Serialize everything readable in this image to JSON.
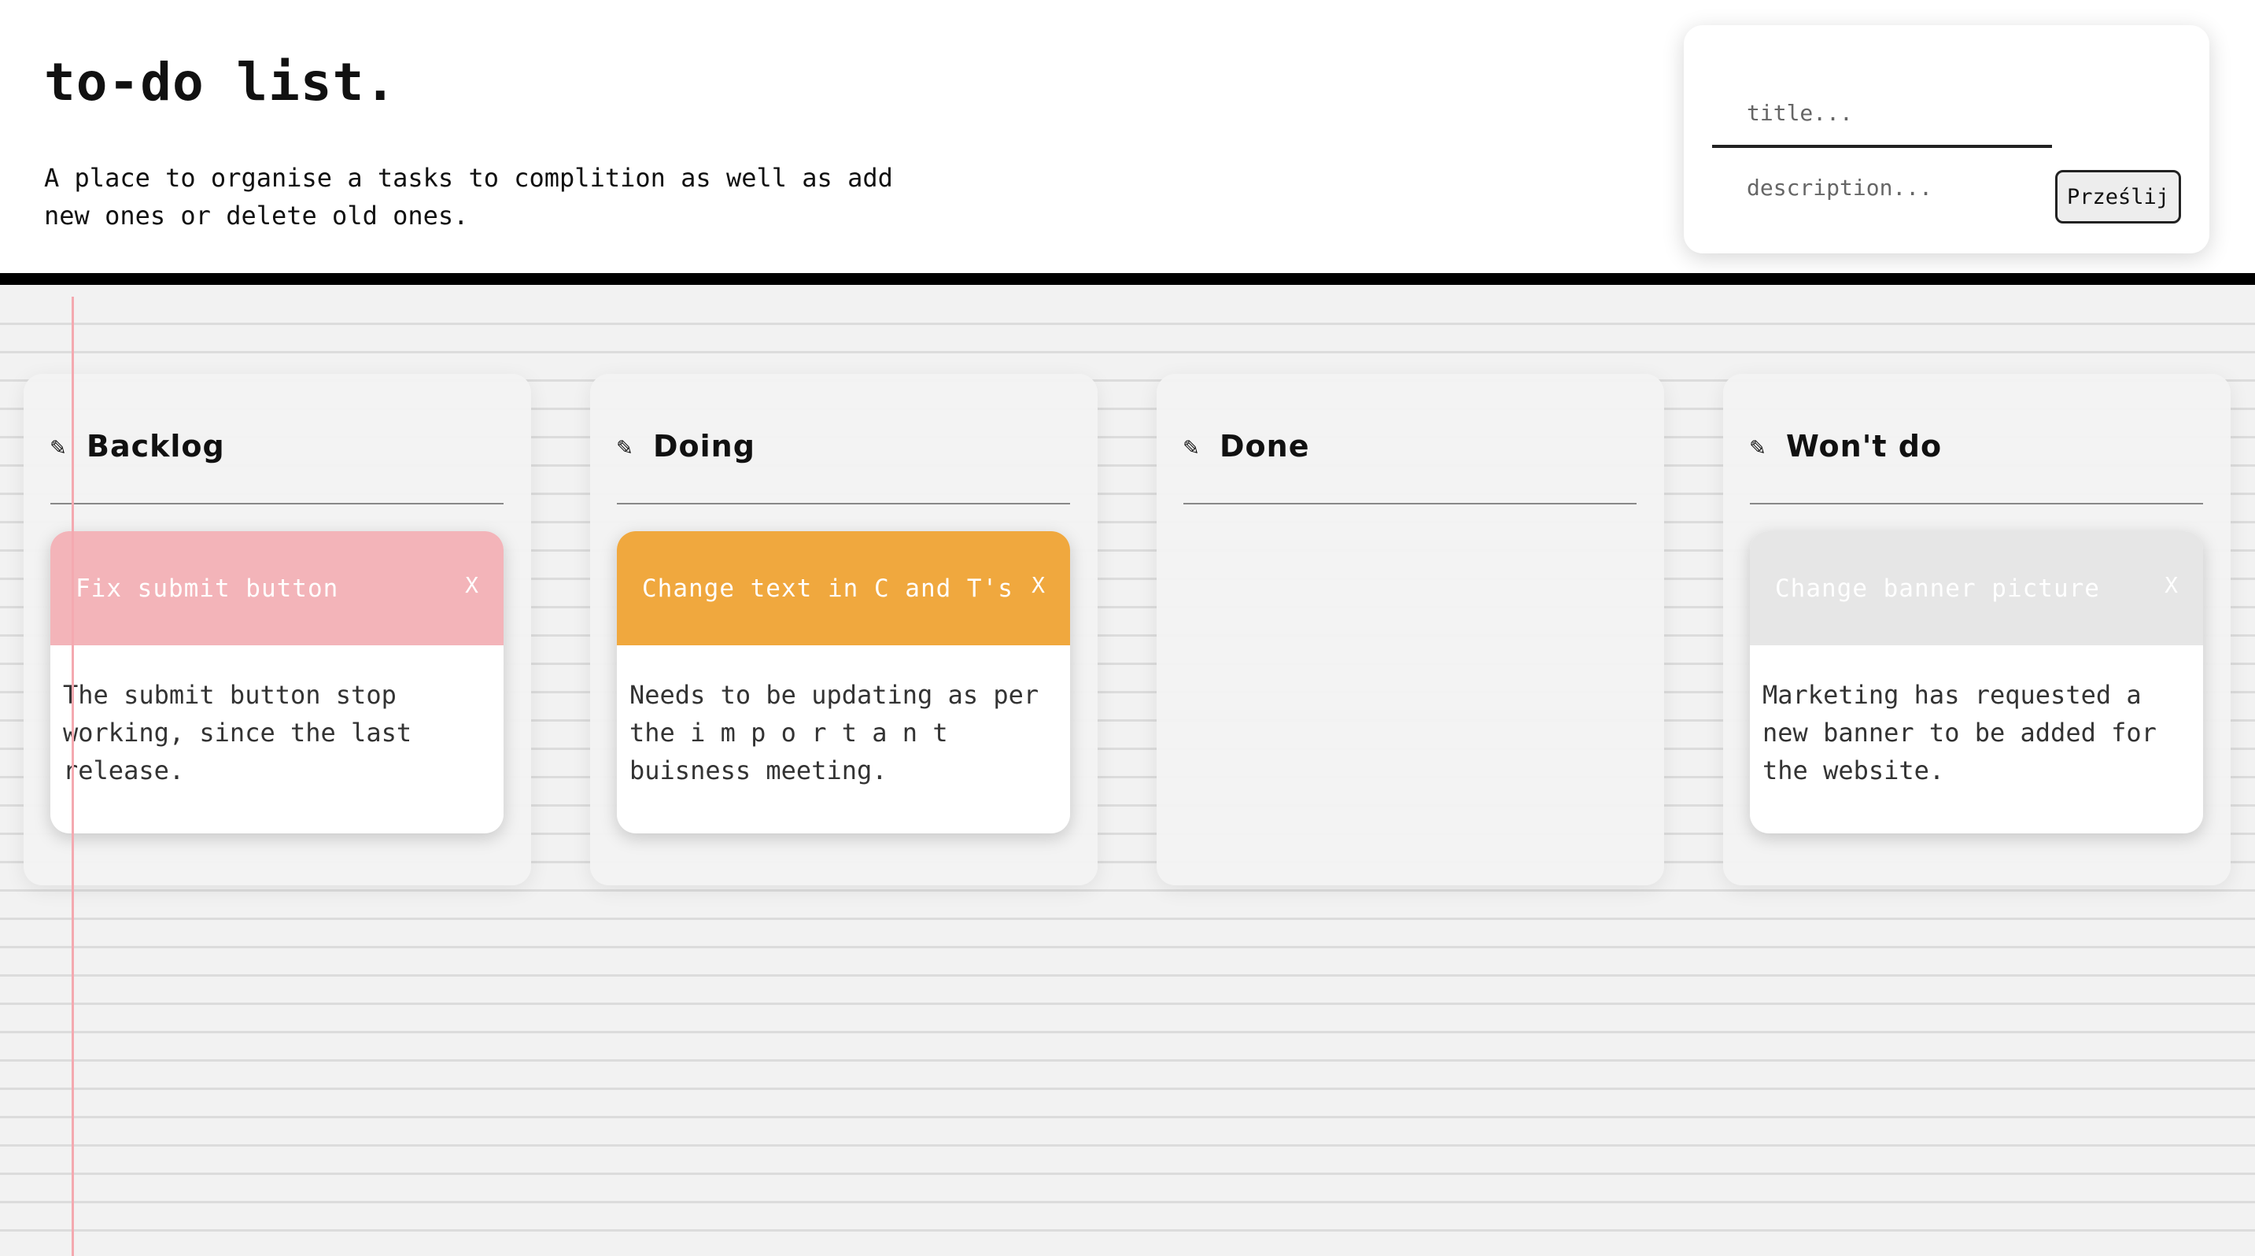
{
  "header": {
    "title": "to-do list.",
    "description": "A place to organise a tasks to complition as well as add new ones or delete old ones."
  },
  "form": {
    "title_placeholder": "title...",
    "description_placeholder": "description...",
    "submit_label": "Prześlij"
  },
  "columns": [
    {
      "name": "Backlog",
      "icon": "pencil-icon",
      "tasks": [
        {
          "title": "Fix submit button",
          "close_label": "X",
          "color": "#f3b4b9",
          "body": "The submit button stop working, since the last release."
        }
      ]
    },
    {
      "name": "Doing",
      "icon": "pencil-icon",
      "tasks": [
        {
          "title": "Change text in C and T's",
          "close_label": "X",
          "color": "#f0a83e",
          "body": "Needs to be updating as per the i m p o r t a n t buisness meeting."
        }
      ]
    },
    {
      "name": "Done",
      "icon": "pencil-icon",
      "tasks": []
    },
    {
      "name": "Won't do",
      "icon": "pencil-icon",
      "tasks": [
        {
          "title": "Change banner picture",
          "close_label": "X",
          "color": "#e6e6e6",
          "body": "Marketing has requested a new banner to be added for the website."
        }
      ]
    }
  ],
  "colors": {
    "header_border": "#000000",
    "margin_line": "#f4a9b0",
    "paper_line": "#dcdcdc",
    "background": "#f2f2f2"
  }
}
